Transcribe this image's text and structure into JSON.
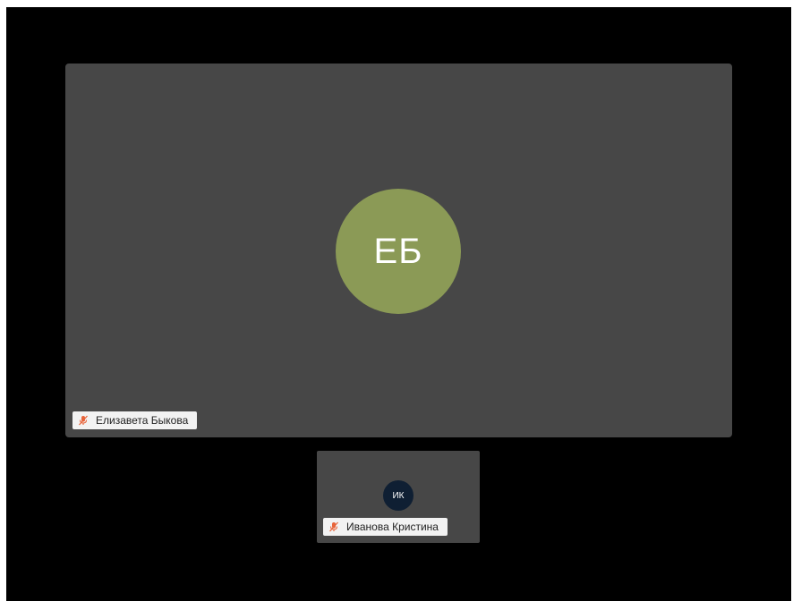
{
  "participants": {
    "main": {
      "initials": "ЕБ",
      "name": "Елизавета Быкова",
      "avatar_color": "#8b9a56",
      "muted": true,
      "mic_icon": "mic-off-icon"
    },
    "thumb": {
      "initials": "ИК",
      "name": "Иванова Кристина",
      "avatar_color": "#0f1f33",
      "muted": true,
      "mic_icon": "mic-off-icon"
    }
  },
  "colors": {
    "stage_background": "#000000",
    "tile_background": "#474747",
    "name_tag_background": "#f2f2f2",
    "muted_icon": "#e8643a"
  }
}
